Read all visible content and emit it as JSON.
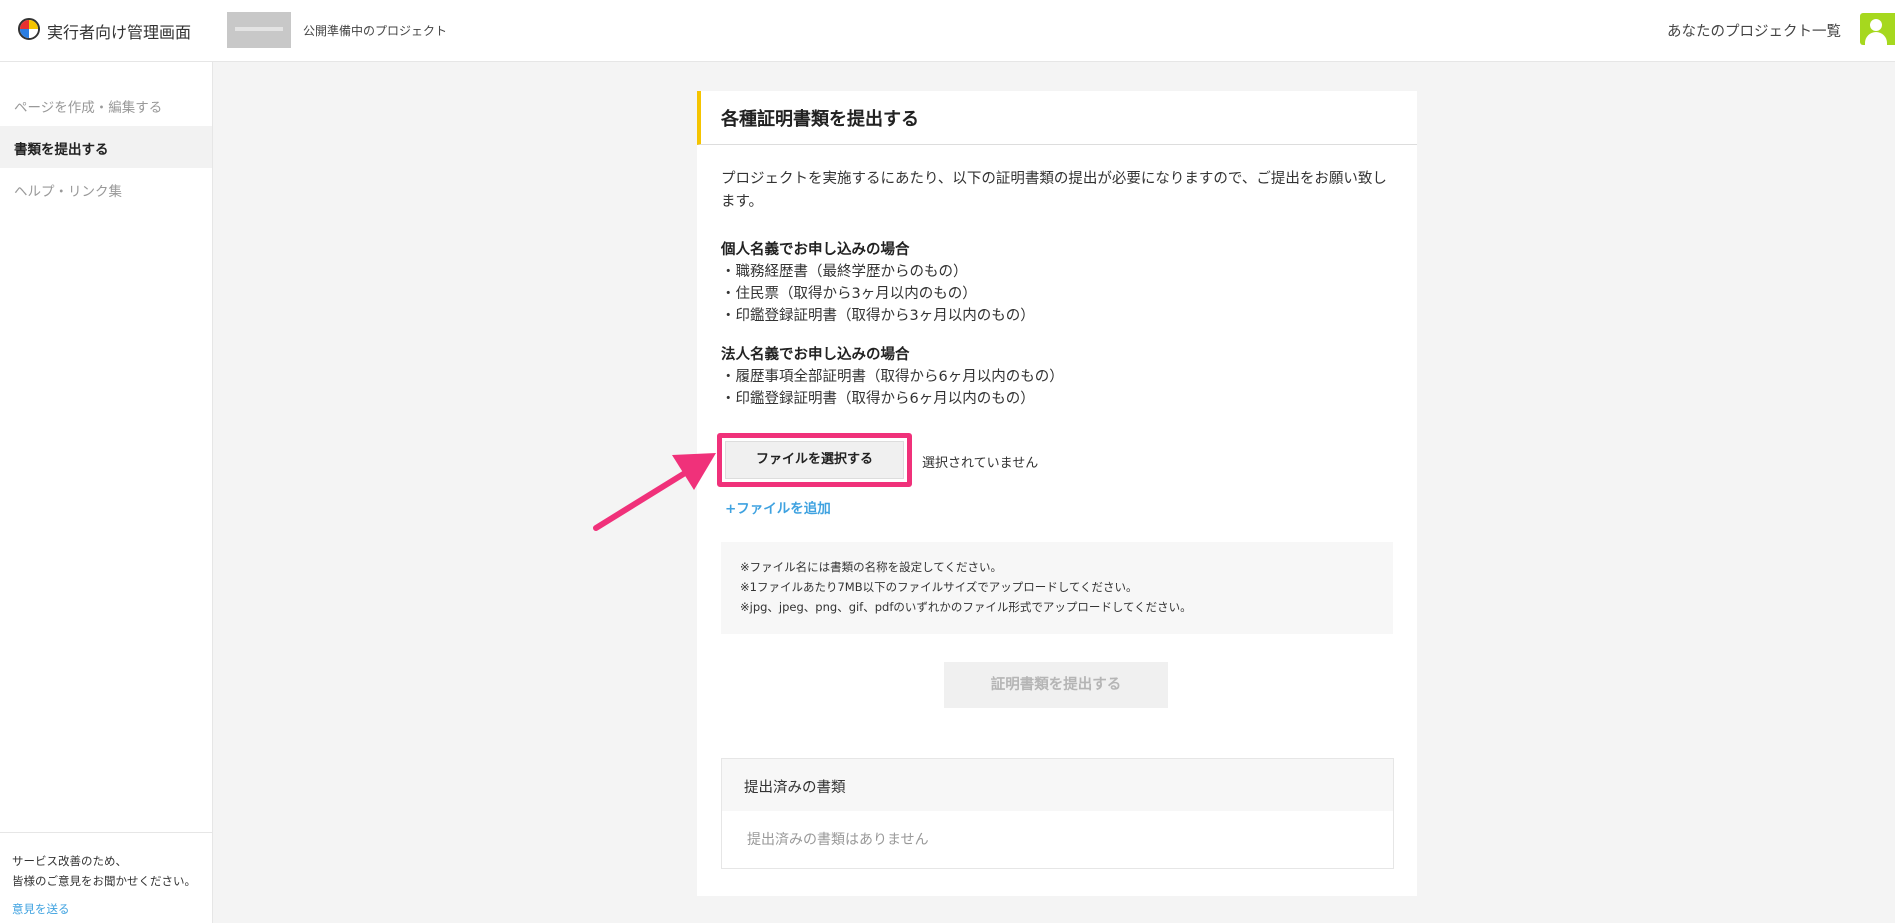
{
  "header": {
    "app_title": "実行者向け管理画面",
    "project_status": "公開準備中のプロジェクト",
    "projects_link": "あなたのプロジェクト一覧"
  },
  "sidebar": {
    "items": [
      {
        "label": "ページを作成・編集する",
        "active": false
      },
      {
        "label": "書類を提出する",
        "active": true
      },
      {
        "label": "ヘルプ・リンク集",
        "active": false
      }
    ],
    "footer_line1": "サービス改善のため、",
    "footer_line2": "皆様のご意見をお聞かせください。",
    "feedback_link": "意見を送る"
  },
  "main": {
    "title": "各種証明書類を提出する",
    "intro": "プロジェクトを実施するにあたり、以下の証明書類の提出が必要になりますので、ご提出をお願い致します。",
    "individual": {
      "heading": "個人名義でお申し込みの場合",
      "docs": [
        "・職務経歴書（最終学歴からのもの）",
        "・住民票（取得から3ヶ月以内のもの）",
        "・印鑑登録証明書（取得から3ヶ月以内のもの）"
      ]
    },
    "corporate": {
      "heading": "法人名義でお申し込みの場合",
      "docs": [
        "・履歴事項全部証明書（取得から6ヶ月以内のもの）",
        "・印鑑登録証明書（取得から6ヶ月以内のもの）"
      ]
    },
    "file_button": "ファイルを選択する",
    "file_status": "選択されていません",
    "add_file": "+ファイルを追加",
    "notes": [
      "※ファイル名には書類の名称を設定してください。",
      "※1ファイルあたり7MB以下のファイルサイズでアップロードしてください。",
      "※jpg、jpeg、png、gif、pdfのいずれかのファイル形式でアップロードしてください。"
    ],
    "submit_button": "証明書類を提出する",
    "submitted": {
      "heading": "提出済みの書類",
      "empty": "提出済みの書類はありません"
    }
  },
  "colors": {
    "accent_yellow": "#f5c400",
    "highlight_pink": "#f0317a",
    "link_blue": "#3fa2e0",
    "avatar_green": "#a6d81e"
  }
}
